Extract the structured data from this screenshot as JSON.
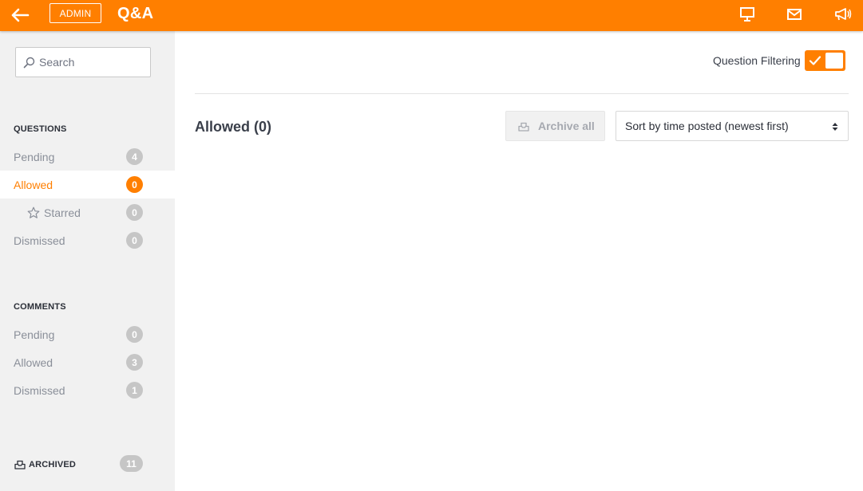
{
  "header": {
    "back_icon": "arrow-left-icon",
    "badge": "ADMIN",
    "title": "Q&A",
    "icons": [
      "presentation-icon",
      "mail-icon",
      "megaphone-icon"
    ],
    "color": "#ff7f00"
  },
  "sidebar": {
    "search": {
      "placeholder": "Search",
      "value": ""
    },
    "questions": {
      "title": "QUESTIONS",
      "items": [
        {
          "label": "Pending",
          "count": "4"
        },
        {
          "label": "Allowed",
          "count": "0",
          "active": true
        },
        {
          "label": "Starred",
          "count": "0",
          "icon": "star-icon"
        },
        {
          "label": "Dismissed",
          "count": "0"
        }
      ]
    },
    "comments": {
      "title": "COMMENTS",
      "items": [
        {
          "label": "Pending",
          "count": "0"
        },
        {
          "label": "Allowed",
          "count": "3"
        },
        {
          "label": "Dismissed",
          "count": "1"
        }
      ]
    },
    "archived": {
      "label": "ARCHIVED",
      "count": "11",
      "icon": "archive-icon"
    }
  },
  "main": {
    "filter_label": "Question Filtering",
    "filter_enabled": true,
    "heading": "Allowed (0)",
    "archive_all_label": "Archive all",
    "sort_label": "Sort by time posted (newest first)"
  }
}
